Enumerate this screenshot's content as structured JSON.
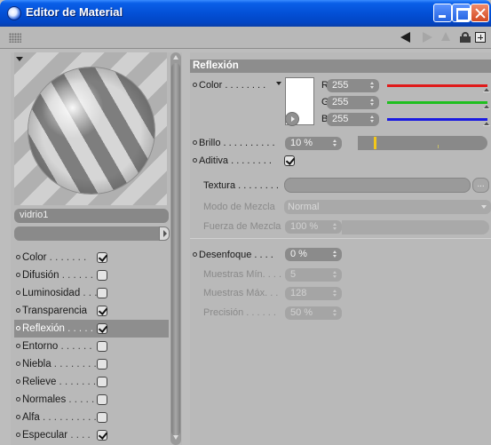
{
  "window": {
    "title": "Editor de Material"
  },
  "preview": {
    "material_name": "vidrio1"
  },
  "channels": [
    {
      "label": "Color",
      "checked": true,
      "selected": false
    },
    {
      "label": "Difusión",
      "checked": false,
      "selected": false
    },
    {
      "label": "Luminosidad",
      "checked": false,
      "selected": false
    },
    {
      "label": "Transparencia",
      "checked": true,
      "selected": false
    },
    {
      "label": "Reflexión",
      "checked": true,
      "selected": true
    },
    {
      "label": "Entorno",
      "checked": false,
      "selected": false
    },
    {
      "label": "Niebla",
      "checked": false,
      "selected": false
    },
    {
      "label": "Relieve",
      "checked": false,
      "selected": false
    },
    {
      "label": "Normales",
      "checked": false,
      "selected": false
    },
    {
      "label": "Alfa",
      "checked": false,
      "selected": false
    },
    {
      "label": "Especular",
      "checked": true,
      "selected": false
    }
  ],
  "reflexion": {
    "header": "Reflexión",
    "color_label": "Color",
    "r_label": "R",
    "g_label": "G",
    "b_label": "B",
    "r_value": "255",
    "g_value": "255",
    "b_value": "255",
    "brillo_label": "Brillo",
    "brillo_value": "10 %",
    "aditiva_label": "Aditiva",
    "aditiva_checked": true,
    "textura_label": "Textura",
    "textura_more": "...",
    "modo_label": "Modo de Mezcla",
    "modo_value": "Normal",
    "fuerza_label": "Fuerza de Mezcla",
    "fuerza_value": "100 %",
    "desenfoque_label": "Desenfoque",
    "desenfoque_value": "0 %",
    "muestras_min_label": "Muestras Mín.",
    "muestras_min_value": "5",
    "muestras_max_label": "Muestras Máx.",
    "muestras_max_value": "128",
    "precision_label": "Precisión",
    "precision_value": "50 %"
  },
  "colors": {
    "swatch": "#ffffff",
    "r_slider": "#e01a1a",
    "g_slider": "#1fbf1f",
    "b_slider": "#1a1ae0",
    "brillo_marker": "#f4c81a"
  },
  "icons": [
    "app-icon",
    "minimize-icon",
    "maximize-icon",
    "close-icon",
    "grip-icon",
    "back-arrow-icon",
    "forward-arrow-icon",
    "up-arrow-icon",
    "lock-icon",
    "new-window-icon"
  ]
}
